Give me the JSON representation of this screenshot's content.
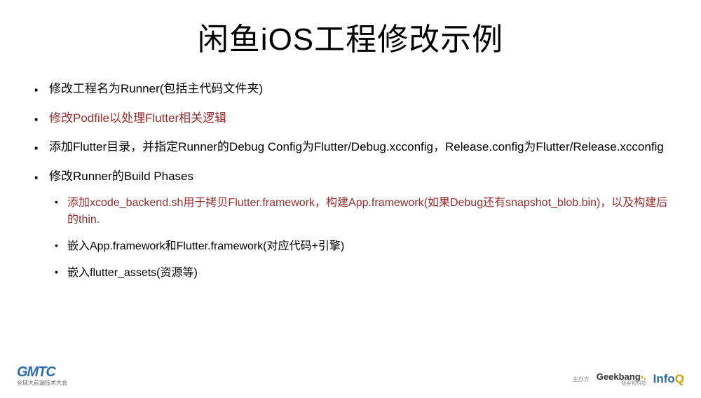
{
  "title": "闲鱼iOS工程修改示例",
  "bullets": {
    "b1": "修改工程名为Runner(包括主代码文件夹)",
    "b2": "修改Podfile以处理Flutter相关逻辑",
    "b3": "添加Flutter目录，并指定Runner的Debug Config为Flutter/Debug.xcconfig，Release.config为Flutter/Release.xcconfig",
    "b4": "修改Runner的Build Phases",
    "b4_sub1": "添加xcode_backend.sh用于拷贝Flutter.framework，构建App.framework(如果Debug还有snapshot_blob.bin)，以及构建后的thin.",
    "b4_sub2": "嵌入App.framework和Flutter.framework(对应代码+引擎)",
    "b4_sub3": "嵌入flutter_assets(资源等)"
  },
  "footer": {
    "gmtc": "GMTC",
    "gmtc_sub": "全球大前端技术大会",
    "label": "主办方",
    "geekbang": "Geekbang",
    "geekbang_suffix": "›.",
    "geekbang_sub": "极客邦科技",
    "infoq_prefix": "Info",
    "infoq_q": "Q"
  }
}
